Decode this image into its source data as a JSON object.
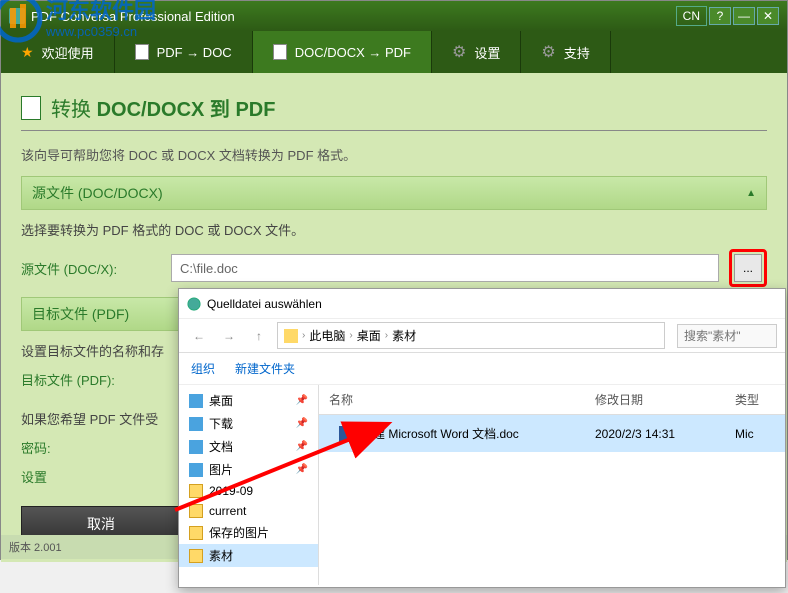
{
  "window": {
    "title": "PDF Conversa Professional Edition",
    "lang": "CN",
    "version": "版本 2.001"
  },
  "watermark": {
    "line1": "河东软件园",
    "line2": "www.pc0359.cn"
  },
  "tabs": {
    "welcome": "欢迎使用",
    "pdf_to_doc": "PDF → DOC",
    "doc_to_pdf": "DOC/DOCX → PDF",
    "settings": "设置",
    "support": "支持"
  },
  "page": {
    "title_prefix": "转换 ",
    "title_strong": "DOC/DOCX 到 PDF",
    "description": "该向导可帮助您将 DOC 或 DOCX 文档转换为 PDF 格式。"
  },
  "source": {
    "header": "源文件 (DOC/DOCX)",
    "description": "选择要转换为 PDF 格式的 DOC 或 DOCX 文件。",
    "label": "源文件 (DOC/X):",
    "value": "C:\\file.doc"
  },
  "target": {
    "header": "目标文件 (PDF)",
    "description": "设置目标文件的名称和存",
    "label": "目标文件 (PDF):"
  },
  "encrypt": {
    "description": "如果您希望 PDF 文件受",
    "password_label": "密码:",
    "settings_label": "设置"
  },
  "buttons": {
    "cancel": "取消"
  },
  "file_dialog": {
    "title": "Quelldatei auswählen",
    "breadcrumb": [
      "此电脑",
      "桌面",
      "素材"
    ],
    "search_placeholder": "搜索\"素材\"",
    "toolbar": {
      "organize": "组织",
      "new_folder": "新建文件夹"
    },
    "sidebar": [
      {
        "icon": "desktop",
        "label": "桌面",
        "pinned": true
      },
      {
        "icon": "download",
        "label": "下载",
        "pinned": true
      },
      {
        "icon": "doc",
        "label": "文档",
        "pinned": true
      },
      {
        "icon": "pic",
        "label": "图片",
        "pinned": true
      },
      {
        "icon": "folder",
        "label": "2019-09"
      },
      {
        "icon": "folder",
        "label": "current"
      },
      {
        "icon": "folder",
        "label": "保存的图片"
      },
      {
        "icon": "folder",
        "label": "素材",
        "selected": true
      }
    ],
    "columns": {
      "name": "名称",
      "date": "修改日期",
      "type": "类型"
    },
    "files": [
      {
        "name": "新建 Microsoft Word 文档.doc",
        "date": "2020/2/3 14:31",
        "type": "Mic",
        "selected": true
      }
    ]
  }
}
